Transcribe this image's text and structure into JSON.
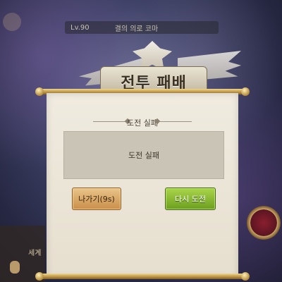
{
  "background": {
    "top_bar": {
      "level": "Lv.90",
      "name": "결의 의로 코마"
    }
  },
  "title": {
    "text": "전투 패배"
  },
  "dialog": {
    "heading": "도전 실패",
    "message": "도전 실패",
    "buttons": {
      "exit_label": "나가기(9s)",
      "retry_label": "다시 도전"
    }
  },
  "hud": {
    "left_label": "세계"
  },
  "colors": {
    "exit_button": "#c98f48",
    "retry_button": "#6c9e1f",
    "panel": "#ebe5d7"
  }
}
